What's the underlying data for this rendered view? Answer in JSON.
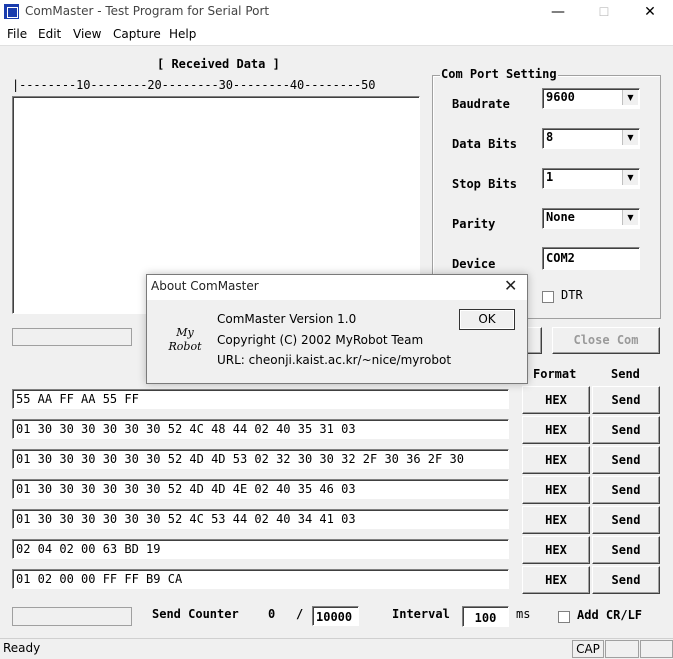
{
  "window": {
    "title": "ComMaster - Test Program for Serial Port",
    "minimize": "—",
    "maximize": "☐",
    "close": "✕"
  },
  "menu": [
    "File",
    "Edit",
    "View",
    "Capture",
    "Help"
  ],
  "received": {
    "header": "[ Received Data ]",
    "ruler": "|--------10--------20--------30--------40--------50"
  },
  "com_port": {
    "title": "Com Port Setting",
    "baudrate_label": "Baudrate",
    "baudrate_value": "9600",
    "databits_label": "Data Bits",
    "databits_value": "8",
    "stopbits_label": "Stop Bits",
    "stopbits_value": "1",
    "parity_label": "Parity",
    "parity_value": "None",
    "device_label": "Device",
    "device_value": "COM2",
    "dtr_label": "DTR",
    "close_com": "Close Com"
  },
  "about": {
    "title": "About ComMaster",
    "version": "ComMaster Version 1.0",
    "copyright": "Copyright (C) 2002 MyRobot Team",
    "url": "URL: cheonji.kaist.ac.kr/~nice/myrobot",
    "ok": "OK",
    "logo_line1": "My",
    "logo_line2": "Robot"
  },
  "send_panel": {
    "format_header": "Format",
    "send_header": "Send",
    "rows": [
      {
        "data": "55 AA FF AA 55 FF",
        "format": "HEX",
        "send": "Send"
      },
      {
        "data": "01 30 30 30 30 30 30 52 4C 48 44 02 40 35 31 03",
        "format": "HEX",
        "send": "Send"
      },
      {
        "data": "01 30 30 30 30 30 30 52 4D 4D 53 02 32 30 30 32 2F 30 36 2F 30",
        "format": "HEX",
        "send": "Send"
      },
      {
        "data": "01 30 30 30 30 30 30 52 4D 4D 4E 02 40 35 46 03",
        "format": "HEX",
        "send": "Send"
      },
      {
        "data": "01 30 30 30 30 30 30 52 4C 53 44 02 40 34 41 03",
        "format": "HEX",
        "send": "Send"
      },
      {
        "data": "02 04 02 00 63 BD 19",
        "format": "HEX",
        "send": "Send"
      },
      {
        "data": "01 02 00 00 FF FF B9 CA",
        "format": "HEX",
        "send": "Send"
      }
    ]
  },
  "bottom": {
    "send_counter_label": "Send Counter",
    "counter_value": "0",
    "slash": "/",
    "counter_max": "10000",
    "interval_label": "Interval",
    "interval_value": "100",
    "ms_label": "ms",
    "add_crlf_label": "Add CR/LF"
  },
  "status": {
    "text": "Ready",
    "cap": "CAP"
  }
}
